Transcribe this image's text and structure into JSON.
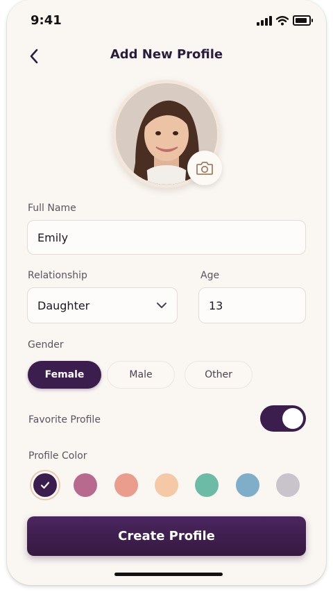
{
  "status": {
    "time": "9:41"
  },
  "header": {
    "title": "Add New Profile"
  },
  "form": {
    "full_name": {
      "label": "Full Name",
      "value": "Emily"
    },
    "relationship": {
      "label": "Relationship",
      "value": "Daughter"
    },
    "age": {
      "label": "Age",
      "value": "13"
    },
    "gender": {
      "label": "Gender",
      "options": [
        "Female",
        "Male",
        "Other"
      ],
      "selected": "Female"
    },
    "favorite": {
      "label": "Favorite Profile",
      "on": true
    },
    "profile_color": {
      "label": "Profile Color",
      "colors": [
        "#3b1e4e",
        "#b7698e",
        "#ea9c8d",
        "#f5c9a6",
        "#6bbba7",
        "#7eaec8",
        "#c9c3cb"
      ],
      "selected_index": 0
    }
  },
  "actions": {
    "create_label": "Create Profile"
  },
  "icons": {
    "back": "chevron-left-icon",
    "camera": "camera-icon",
    "dropdown": "chevron-down-icon",
    "check": "check-icon"
  }
}
